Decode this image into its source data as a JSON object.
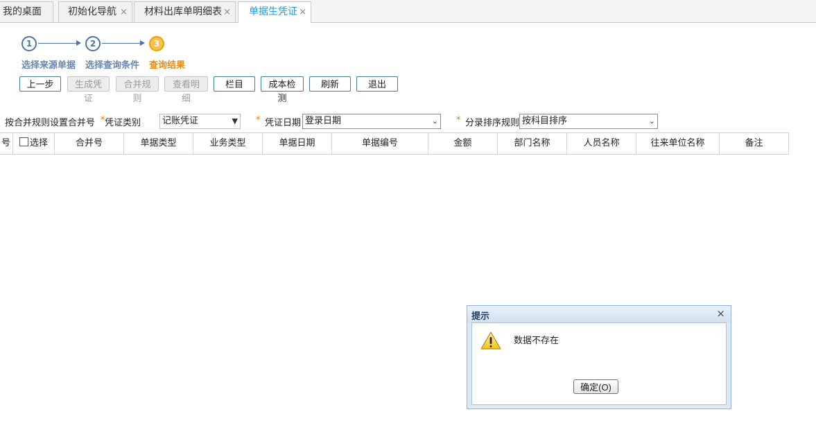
{
  "tabs": [
    {
      "label": "我的桌面",
      "closable": false,
      "active": false
    },
    {
      "label": "初始化导航",
      "closable": true,
      "active": false
    },
    {
      "label": "材料出库单明细表",
      "closable": true,
      "active": false
    },
    {
      "label": "单据生凭证",
      "closable": true,
      "active": true
    }
  ],
  "close_glyph": "×",
  "steps": [
    {
      "number": "1",
      "label": "选择来源单据"
    },
    {
      "number": "2",
      "label": "选择查询条件"
    },
    {
      "number": "3",
      "label": "查询结果",
      "current": true
    }
  ],
  "toolbar": {
    "prev": "上一步",
    "generate": "生成凭证",
    "merge_rule": "合并规则",
    "view_detail": "查看明细",
    "columns": "栏目",
    "cost_check": "成本检测",
    "refresh": "刷新",
    "exit": "退出"
  },
  "filters": {
    "merge_label": "按合并规则设置合并号",
    "required_mark": "*",
    "voucher_type_label": "凭证类别",
    "voucher_type_value": "记账凭证",
    "voucher_date_label": "凭证日期",
    "voucher_date_value": "登录日期",
    "sort_rule_label": "分录排序规则",
    "sort_rule_value": "按科目排序"
  },
  "grid": {
    "columns": [
      "号",
      "选择",
      "合并号",
      "单据类型",
      "业务类型",
      "单据日期",
      "单据编号",
      "金额",
      "部门名称",
      "人员名称",
      "往来单位名称",
      "备注"
    ],
    "rows": []
  },
  "dialog": {
    "title": "提示",
    "close": "×",
    "message": "数据不存在",
    "ok_label": "确定(O)",
    "icon": "warning-icon"
  },
  "colors": {
    "accent": "#1f9ad6",
    "step_current": "#e38c1a",
    "step_done_fill": "#f7c24a",
    "required": "#f07a00"
  }
}
